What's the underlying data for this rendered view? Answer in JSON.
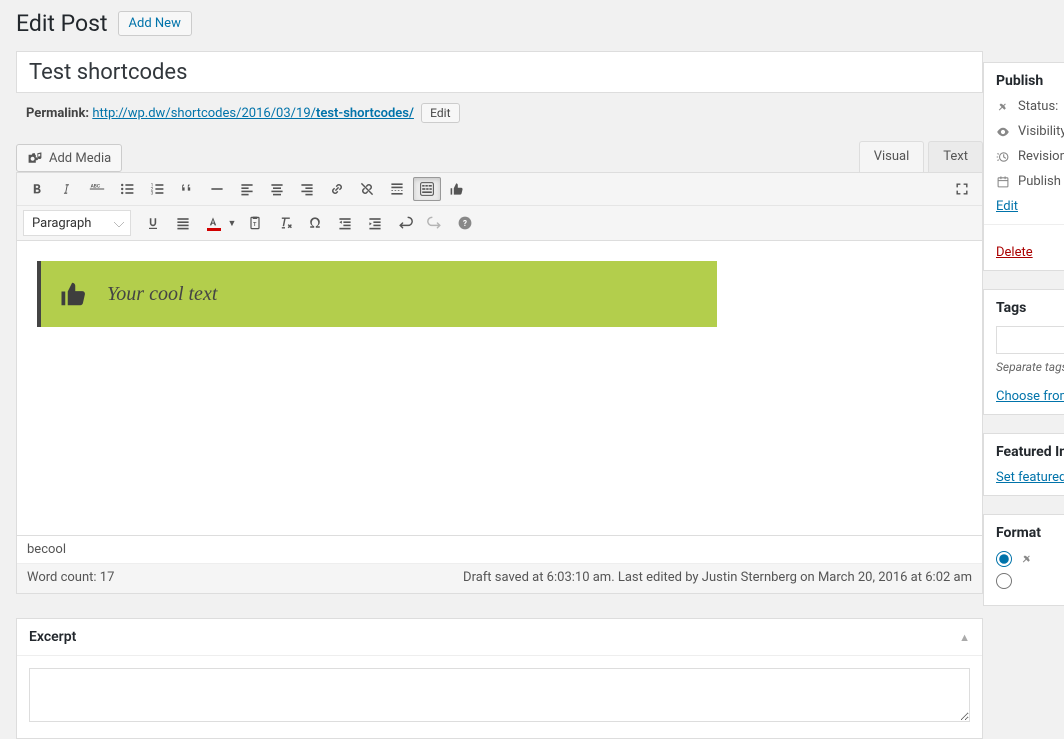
{
  "heading": {
    "title": "Edit Post",
    "add_new": "Add New"
  },
  "post": {
    "title": "Test shortcodes",
    "permalink_label": "Permalink:",
    "permalink_base": "http://wp.dw/shortcodes/2016/03/19/",
    "permalink_slug": "test-shortcodes/",
    "edit_btn": "Edit"
  },
  "media_button": "Add Media",
  "tabs": {
    "visual": "Visual",
    "text": "Text"
  },
  "format_select": "Paragraph",
  "shortcode_preview": {
    "text": "Your cool text"
  },
  "status_path": "becool",
  "footer": {
    "word_count_label": "Word count:",
    "word_count": "17",
    "draft_status": "Draft saved at 6:03:10 am. Last edited by Justin Sternberg on March 20, 2016 at 6:02 am"
  },
  "excerpt": {
    "title": "Excerpt",
    "value": ""
  },
  "sidebar": {
    "publish": {
      "title": "Publish",
      "rows": [
        "Status:",
        "Visibility:",
        "Revisions:",
        "Publish"
      ],
      "edit_link": "Edit",
      "delete": "Delete"
    },
    "tags": {
      "title": "Tags",
      "separator_hint": "Separate tags with commas",
      "choose": "Choose from the most used tags"
    },
    "featured": {
      "title": "Featured Image",
      "set_link": "Set featured image"
    },
    "format": {
      "title": "Format"
    }
  }
}
